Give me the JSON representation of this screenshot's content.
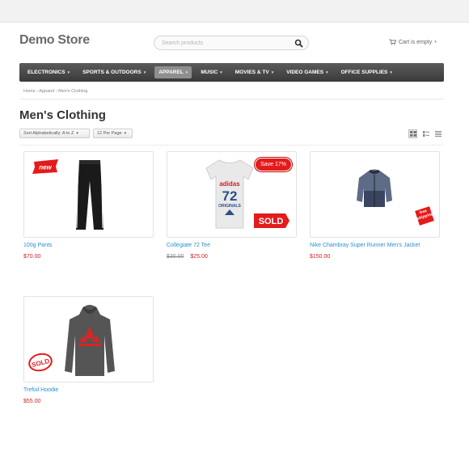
{
  "store": {
    "name": "Demo Store"
  },
  "search": {
    "placeholder": "Search products"
  },
  "cart": {
    "label": "Cart is empty"
  },
  "nav": [
    {
      "label": "ELECTRONICS",
      "active": false
    },
    {
      "label": "SPORTS & OUTDOORS",
      "active": false
    },
    {
      "label": "APPAREL",
      "active": true
    },
    {
      "label": "MUSIC",
      "active": false
    },
    {
      "label": "MOVIES & TV",
      "active": false
    },
    {
      "label": "VIDEO GAMES",
      "active": false
    },
    {
      "label": "OFFICE SUPPLIES",
      "active": false
    }
  ],
  "breadcrumb": {
    "home": "Home",
    "category": "Apparel",
    "current": "Men's Clothing",
    "separator": "›"
  },
  "page": {
    "title": "Men's Clothing"
  },
  "toolbar": {
    "sort_label": "Sort Alphabetically: A to Z",
    "per_page_label": "12 Per Page",
    "views": [
      "grid-view-icon",
      "list-view-icon",
      "table-view-icon"
    ],
    "active_view": "grid-view-icon"
  },
  "products": [
    {
      "name": "100g Pants",
      "price": "$70.00",
      "old_price": "",
      "badge": "new"
    },
    {
      "name": "Collegiate 72 Tee",
      "price": "$25.00",
      "old_price": "$30.00",
      "badge": "Save 17%",
      "stamp": "SOLD"
    },
    {
      "name": "Nike Chambray Super Runner Men's Jacket",
      "price": "$150.00",
      "old_price": "",
      "stamp": "free shipping"
    },
    {
      "name": "Trefoil Hoodie",
      "price": "$55.00",
      "old_price": "",
      "stamp": "SOLD"
    }
  ],
  "tee_graphic": {
    "brand": "adidas",
    "number": "72",
    "sub": "ORIGINALS"
  },
  "colors": {
    "accent": "#2a8fd1",
    "price": "#cc2222",
    "nav_bg": "#444444",
    "badge": "#e41b1b"
  }
}
